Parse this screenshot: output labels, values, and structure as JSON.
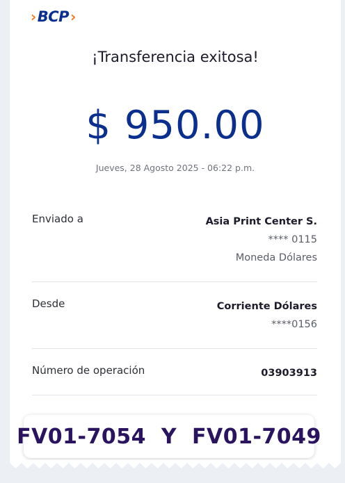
{
  "brand": {
    "logo_text": "BCP"
  },
  "receipt": {
    "title": "¡Transferencia exitosa!",
    "amount": "$ 950.00",
    "datetime": "Jueves, 28 Agosto 2025 - 06:22 p.m."
  },
  "sent_to": {
    "label": "Enviado a",
    "name": "Asia Print Center S.",
    "account": "**** 0115",
    "currency": "Moneda Dólares"
  },
  "from": {
    "label": "Desde",
    "account_type": "Corriente Dólares",
    "account": "****0156"
  },
  "operation": {
    "label": "Número de operación",
    "number": "03903913"
  },
  "note_banner": {
    "text": "FV01-7054  Y  FV01-7049"
  },
  "colors": {
    "brand_blue": "#0a2f8f",
    "brand_orange": "#f47b20",
    "banner_text": "#2a1460"
  }
}
